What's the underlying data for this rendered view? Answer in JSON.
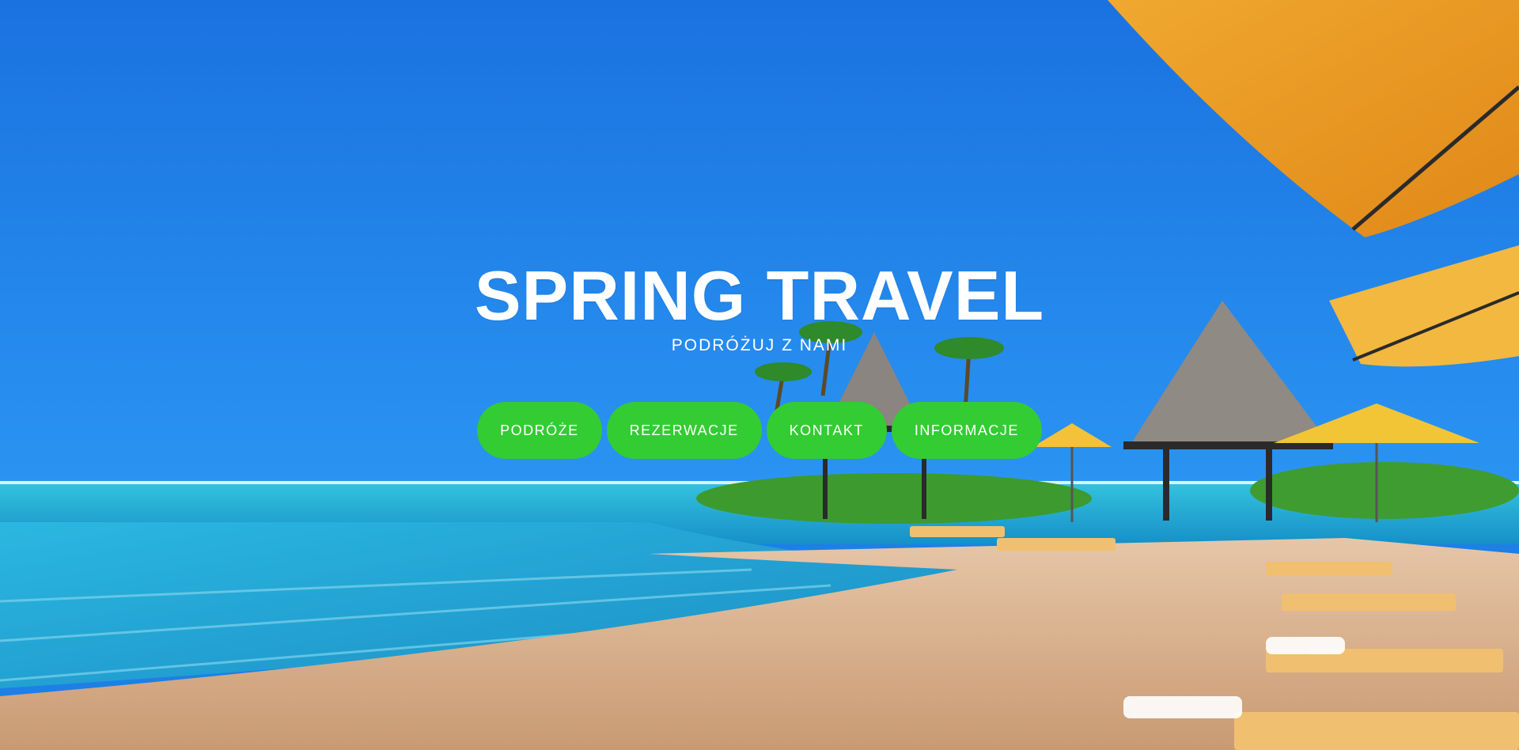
{
  "hero": {
    "title": "SPRING TRAVEL",
    "subtitle": "PODRÓŻUJ Z NAMI",
    "background_image": "tropical-resort-pool-beach-photo"
  },
  "nav": {
    "items": [
      {
        "label": "PODRÓŻE"
      },
      {
        "label": "REZERWACJE"
      },
      {
        "label": "KONTAKT"
      },
      {
        "label": "INFORMACJE"
      }
    ]
  },
  "colors": {
    "button_bg": "#33cc33",
    "button_text": "#ffffff",
    "sky": "#1e7fe6"
  }
}
